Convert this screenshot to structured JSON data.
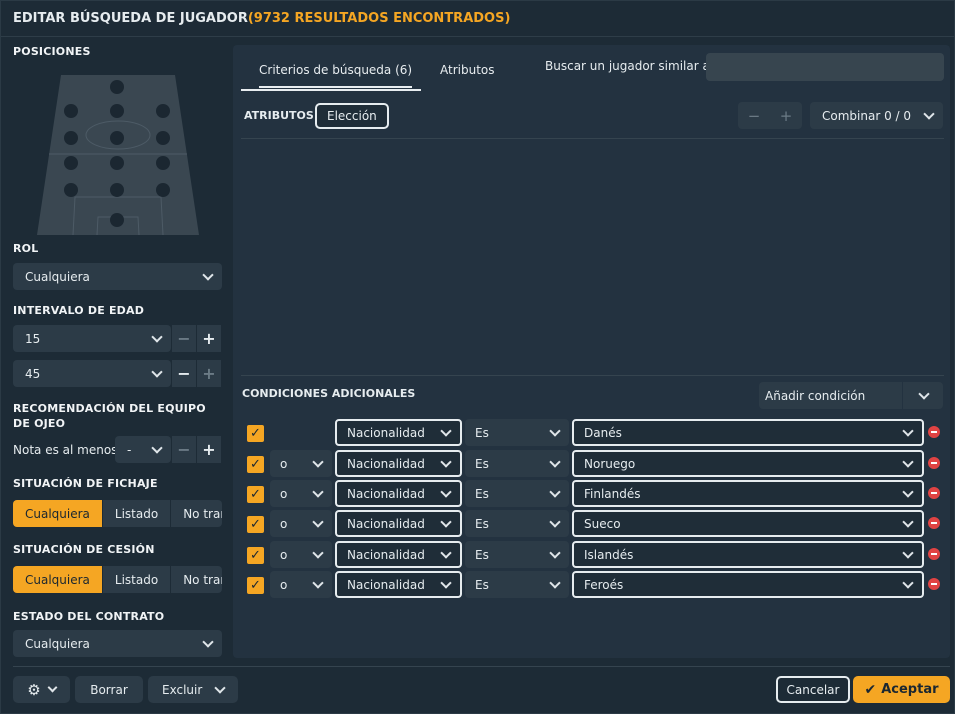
{
  "title": {
    "main": "EDITAR BÚSQUEDA DE JUGADOR",
    "count": "(9732 RESULTADOS ENCONTRADOS)"
  },
  "left": {
    "positions_title": "POSICIONES",
    "role_title": "ROL",
    "role_value": "Cualquiera",
    "age_title": "INTERVALO DE EDAD",
    "age_min": "15",
    "age_max": "45",
    "recommend_title": "RECOMENDACIÓN DEL EQUIPO DE OJEO",
    "rating_label": "Nota es al menos",
    "rating_value": "-",
    "transfer_title": "SITUACIÓN DE FICHAJE",
    "transfer_options": [
      "Cualquiera",
      "Listado",
      "No transferible"
    ],
    "loan_title": "SITUACIÓN DE CESIÓN",
    "loan_options": [
      "Cualquiera",
      "Listado",
      "No transferible"
    ],
    "contract_title": "ESTADO DEL CONTRATO",
    "contract_value": "Cualquiera"
  },
  "tabs": [
    "Criterios de búsqueda (6)",
    "Atributos"
  ],
  "similar_label": "Buscar un jugador similar a",
  "similar_placeholder": "",
  "attributes": {
    "title": "ATRIBUTOS",
    "choice_label": "Elección",
    "minus": "−",
    "plus": "+",
    "combine_label": "Combinar 0 / 0"
  },
  "conditions": {
    "title": "CONDICIONES ADICIONALES",
    "add_label": "Añadir condición",
    "rows": [
      {
        "connector": "",
        "field": "Nacionalidad",
        "op": "Es",
        "value": "Danés"
      },
      {
        "connector": "o",
        "field": "Nacionalidad",
        "op": "Es",
        "value": "Noruego"
      },
      {
        "connector": "o",
        "field": "Nacionalidad",
        "op": "Es",
        "value": "Finlandés"
      },
      {
        "connector": "o",
        "field": "Nacionalidad",
        "op": "Es",
        "value": "Sueco"
      },
      {
        "connector": "o",
        "field": "Nacionalidad",
        "op": "Es",
        "value": "Islandés"
      },
      {
        "connector": "o",
        "field": "Nacionalidad",
        "op": "Es",
        "value": "Feroés"
      }
    ]
  },
  "footer": {
    "reset_label": "Borrar",
    "exclude_label": "Excluir",
    "cancel_label": "Cancelar",
    "accept_label": "Aceptar"
  },
  "colors": {
    "accent": "#f5a623",
    "remove": "#e04343",
    "panel": "#233240"
  }
}
